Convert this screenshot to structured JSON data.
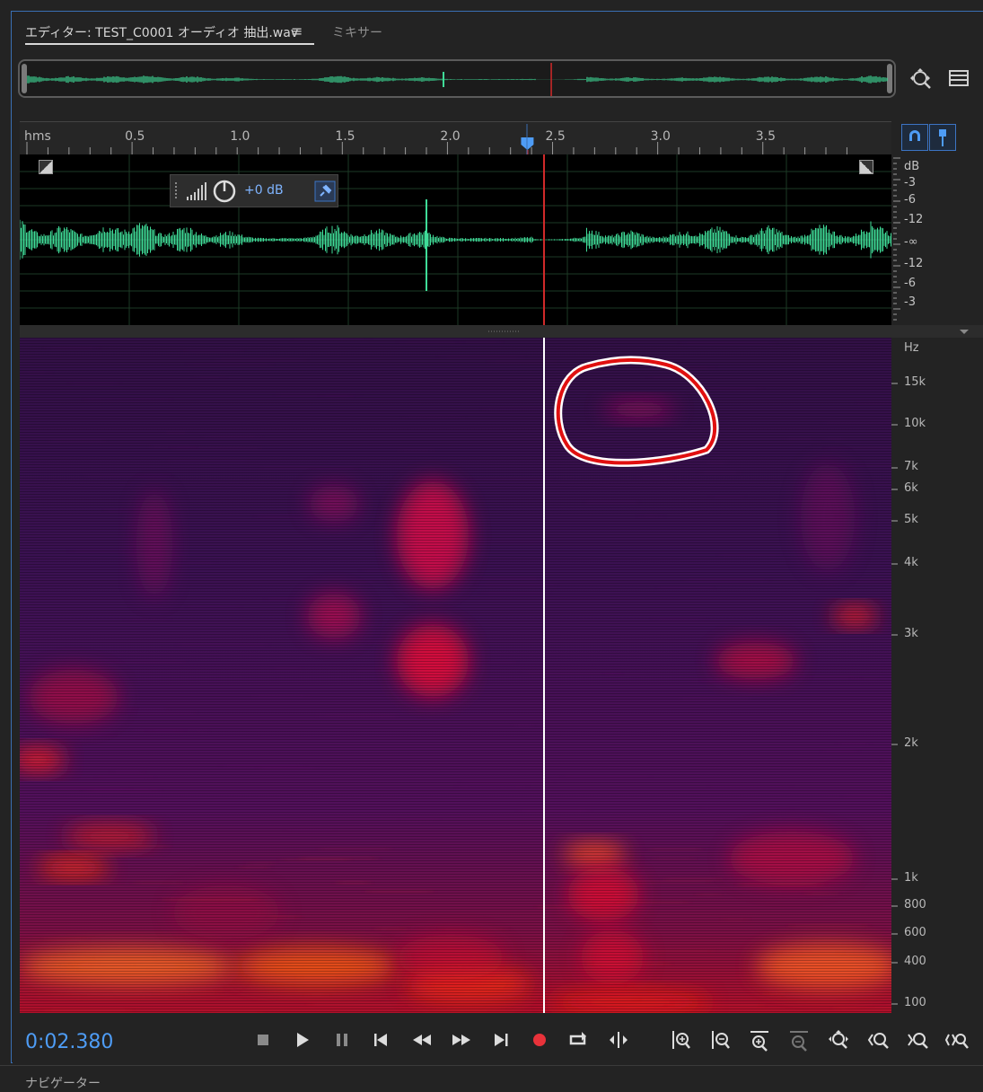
{
  "tabs": {
    "editor_label": "エディター: TEST_C0001 オーディオ 抽出.wav",
    "menu_glyph": "≡",
    "mixer_label": "ミキサー"
  },
  "overview": {
    "zoom_icon": "zoom-navigator-icon",
    "list_icon": "list-icon"
  },
  "ruler": {
    "unit": "hms",
    "ticks": [
      "0.5",
      "1.0",
      "1.5",
      "2.0",
      "2.5",
      "3.0",
      "3.5"
    ],
    "duration_s": 3.98,
    "playhead_s": 2.38
  },
  "hud": {
    "gain": "+0 dB"
  },
  "db_scale": [
    "dB",
    "-3",
    "-6",
    "-12",
    "-∞",
    "-12",
    "-6",
    "-3"
  ],
  "hz_scale": {
    "unit": "Hz",
    "labels": [
      "15k",
      "10k",
      "7k",
      "6k",
      "5k",
      "4k",
      "3k",
      "2k",
      "1k",
      "800",
      "600",
      "400",
      "100"
    ]
  },
  "transport": {
    "timecode": "0:02.380",
    "buttons": [
      "stop-icon",
      "play-icon",
      "pause-icon",
      "go-to-start-icon",
      "rewind-icon",
      "fast-forward-icon",
      "go-to-end-icon",
      "record-icon",
      "loop-icon",
      "skip-selection-icon",
      "zoom-in-amplitude-icon",
      "zoom-out-amplitude-icon",
      "zoom-in-time-icon",
      "zoom-out-time-icon",
      "zoom-out-full-icon",
      "zoom-in-left-icon",
      "zoom-in-right-icon",
      "zoom-selection-icon"
    ]
  },
  "colors": {
    "waveform": "#3fdc98",
    "playhead": "#d02a2a",
    "accent": "#4e9cf5",
    "annotation": "#e01010"
  },
  "bottom": {
    "label": "ナビゲーター"
  }
}
